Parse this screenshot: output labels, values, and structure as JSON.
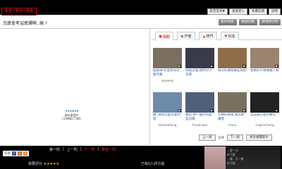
{
  "top": {
    "logo_text": "影音 | 影片 | 頻道",
    "links": [
      "影音首頁▼",
      "會員登入",
      "免費註冊",
      "說明"
    ]
  },
  "question": {
    "text": "怎麼會考這麼爛啊..搞 ?",
    "buttons": [
      "影片列表",
      "頻道訂閱",
      "新增到引用"
    ]
  },
  "player": {
    "loading_text": "資料處理中",
    "connecting_text": "CONNECTING"
  },
  "tabs": [
    {
      "label": "相關",
      "icon": "related-icon"
    },
    {
      "label": "作者",
      "icon": "author-icon"
    },
    {
      "label": "熱門",
      "icon": "hot-icon"
    },
    {
      "label": "好友",
      "icon": "friends-icon"
    }
  ],
  "videos": [
    {
      "title": "超級萌!可愛女孩狂愛作業",
      "user": "jeyweely",
      "bg": "#7b6f62"
    },
    {
      "title": "快點這個,我們的小天使",
      "user": "",
      "bg": "#3a3a4a"
    },
    {
      "title": "每天的課程總是如此",
      "user": "",
      "bg": "#8f6d4a"
    },
    {
      "title": "我真的不想睡覺了啊",
      "user": "",
      "bg": "#9a8470"
    },
    {
      "title": "陳..哪有這麼可愛的說",
      "user": "katsheebeng",
      "bg": "#6d8aa8"
    },
    {
      "title": "寶貝:你一個月的就是這樣",
      "user": "fmiobeaba",
      "bg": "#51607a"
    },
    {
      "title": "人類的爸爸,真的很厲害",
      "user": "mana",
      "bg": "#7a7060"
    },
    {
      "title": "這是最可愛的嬰兒",
      "user": "slcgleecheng",
      "bg": "#222222"
    }
  ],
  "pager": {
    "prev": "上一頁",
    "page": "1/4",
    "next": "下一頁",
    "more": "更多相關影片"
  },
  "bottom": {
    "nav": [
      "第一則",
      "上一則",
      "下一則",
      "最後一則"
    ],
    "share_label": "分享",
    "rating_label": "我要評分",
    "stars": "★★★★★",
    "rating_count": "已有0人評分過",
    "profile_text": [
      "...愛一分.",
      "好可愛",
      "...喔...又一隻",
      "好可愛..."
    ]
  }
}
